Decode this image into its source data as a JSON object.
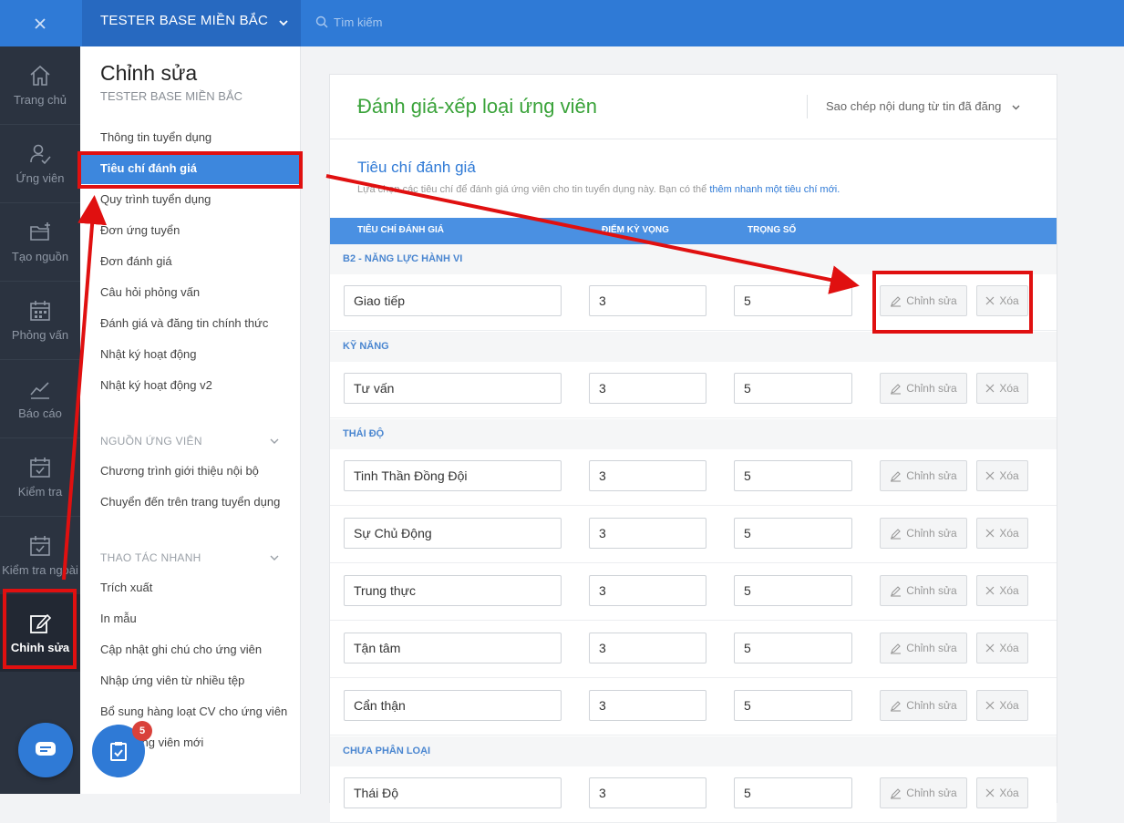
{
  "topbar": {
    "org": "TESTER BASE MIỀN BẮC",
    "search_placeholder": "Tìm kiếm"
  },
  "rail": [
    {
      "label": "Trang chủ",
      "icon": "home-icon"
    },
    {
      "label": "Ứng viên",
      "icon": "user-check-icon"
    },
    {
      "label": "Tạo nguồn",
      "icon": "folder-plus-icon"
    },
    {
      "label": "Phỏng vấn",
      "icon": "calendar-grid-icon"
    },
    {
      "label": "Báo cáo",
      "icon": "line-chart-icon"
    },
    {
      "label": "Kiểm tra",
      "icon": "calendar-check-icon"
    },
    {
      "label": "Kiểm tra ngoài",
      "icon": "calendar-check-icon"
    },
    {
      "label": "Chỉnh sửa",
      "icon": "edit-icon"
    }
  ],
  "sidebar": {
    "title": "Chỉnh sửa",
    "subtitle": "TESTER BASE MIỀN BẮC",
    "items": [
      "Thông tin tuyển dụng",
      "Tiêu chí đánh giá",
      "Quy trình tuyển dụng",
      "Đơn ứng tuyển",
      "Đơn đánh giá",
      "Câu hỏi phỏng vấn",
      "Đánh giá và đăng tin chính thức",
      "Nhật ký hoạt động",
      "Nhật ký hoạt động v2"
    ],
    "section_sources": "NGUỒN ỨNG VIÊN",
    "source_items": [
      "Chương trình giới thiệu nội bộ",
      "Chuyển đến trên trang tuyển dụng"
    ],
    "section_quick": "THAO TÁC NHANH",
    "quick_items": [
      "Trích xuất",
      "In mẫu",
      "Cập nhật ghi chú cho ứng viên",
      "Nhập ứng viên từ nhiều tệp",
      "Bổ sung hàng loạt CV cho ứng viên",
      "Thêm ứng viên mới"
    ],
    "task_badge": "5"
  },
  "main": {
    "title": "Đánh giá-xếp loại ứng viên",
    "copy_link": "Sao chép nội dung từ tin đã đăng",
    "section_title": "Tiêu chí đánh giá",
    "section_desc": "Lựa chọn các tiêu chí để đánh giá ứng viên cho tin tuyển dụng này. Bạn có thể",
    "section_link": "thêm nhanh một tiêu chí mới.",
    "columns": [
      "TIÊU CHÍ ĐÁNH GIÁ",
      "ĐIỂM KỲ VỌNG",
      "TRỌNG SỐ"
    ],
    "edit_label": "Chỉnh sửa",
    "delete_label": "Xóa",
    "groups": [
      {
        "name": "B2 - NĂNG LỰC HÀNH VI",
        "rows": [
          {
            "name": "Giao tiếp",
            "score": "3",
            "weight": "5"
          }
        ]
      },
      {
        "name": "KỸ NĂNG",
        "rows": [
          {
            "name": "Tư vấn",
            "score": "3",
            "weight": "5"
          }
        ]
      },
      {
        "name": "THÁI ĐỘ",
        "rows": [
          {
            "name": "Tinh Thần Đồng Đội",
            "score": "3",
            "weight": "5"
          },
          {
            "name": "Sự Chủ Động",
            "score": "3",
            "weight": "5"
          },
          {
            "name": "Trung thực",
            "score": "3",
            "weight": "5"
          },
          {
            "name": "Tận tâm",
            "score": "3",
            "weight": "5"
          },
          {
            "name": "Cẩn thận",
            "score": "3",
            "weight": "5"
          }
        ]
      },
      {
        "name": "CHƯA PHÂN LOẠI",
        "rows": [
          {
            "name": "Thái Độ",
            "score": "3",
            "weight": "5"
          }
        ]
      }
    ]
  },
  "colors": {
    "topbar": "#2f7ad6",
    "rail": "#2b3340",
    "active_item": "#3d87dd",
    "title_green": "#3aa33a",
    "table_header": "#4a90e2",
    "highlight": "#e01010"
  }
}
